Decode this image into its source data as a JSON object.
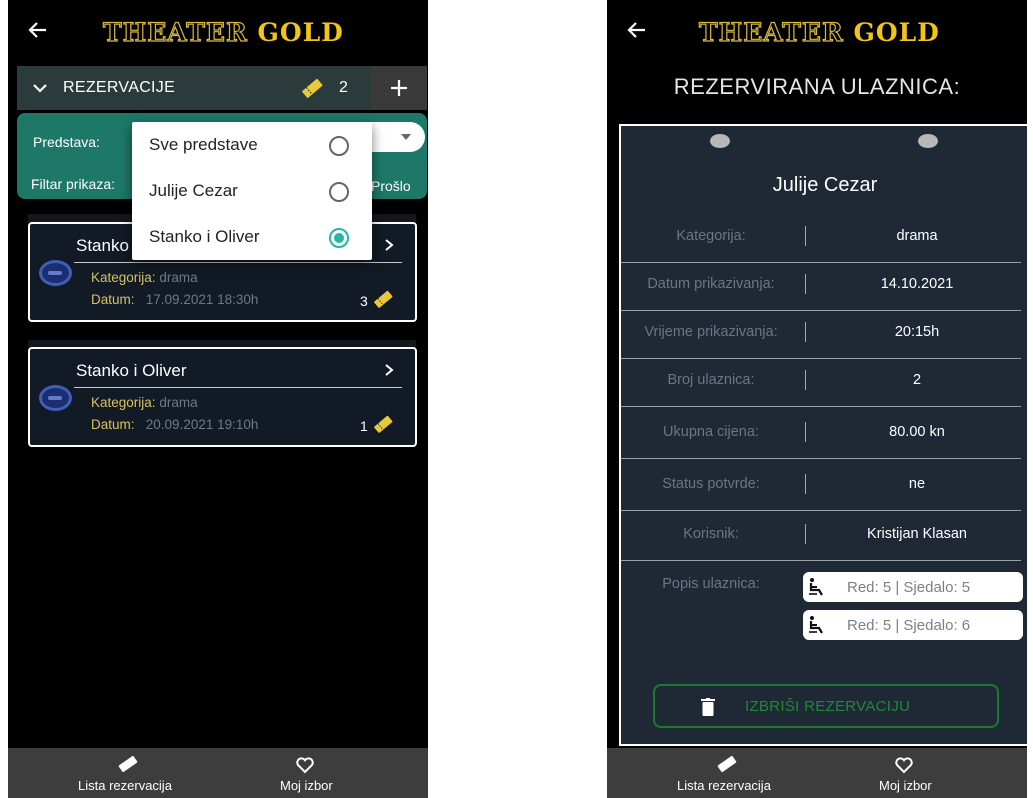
{
  "brand": {
    "word1": "THEATER",
    "word2": "GOLD"
  },
  "left_screen": {
    "section": {
      "title": "REZERVACIJE",
      "count": "2",
      "add_label": "+"
    },
    "filter": {
      "predstava_label": "Predstava:",
      "filtar_label": "Filtar prikaza:",
      "right_option": "Prošlo"
    },
    "dropdown": {
      "options": [
        {
          "label": "Sve predstave",
          "selected": false
        },
        {
          "label": "Julije Cezar",
          "selected": false
        },
        {
          "label": "Stanko i Oliver",
          "selected": true
        }
      ]
    },
    "cards": [
      {
        "title": "Stanko i Oliver",
        "kategorija_label": "Kategorija:",
        "kategorija": "drama",
        "datum_label": "Datum:",
        "datum": "17.09.2021 18:30h",
        "tickets": "3"
      },
      {
        "title": "Stanko i Oliver",
        "kategorija_label": "Kategorija:",
        "kategorija": "drama",
        "datum_label": "Datum:",
        "datum": "20.09.2021 19:10h",
        "tickets": "1"
      }
    ]
  },
  "right_screen": {
    "heading": "REZERVIRANA ULAZNICA:",
    "show_title": "Julije Cezar",
    "rows": [
      {
        "label": "Kategorija:",
        "value": "drama"
      },
      {
        "label": "Datum prikazivanja:",
        "value": "14.10.2021"
      },
      {
        "label": "Vrijeme prikazivanja:",
        "value": "20:15h"
      },
      {
        "label": "Broj ulaznica:",
        "value": "2"
      },
      {
        "label": "Ukupna cijena:",
        "value": "80.00  kn"
      },
      {
        "label": "Status potvrde:",
        "value": "ne"
      },
      {
        "label": "Korisnik:",
        "value": "Kristijan Klasan"
      }
    ],
    "seats_label": "Popis ulaznica:",
    "seats": [
      "Red: 5 | Sjedalo: 5",
      "Red: 5 | Sjedalo: 6"
    ],
    "delete_label": "IZBRIŠI REZERVACIJU"
  },
  "bottom_nav": {
    "item1": "Lista rezervacija",
    "item2": "Moj izbor"
  },
  "colors": {
    "accent_teal": "#1d7868",
    "gold": "#f2c515",
    "radio_on": "#21b8a4",
    "delete_green": "#1e8a33"
  },
  "icons": [
    "back-arrow-icon",
    "chevron-down-icon",
    "ticket-icon",
    "plus-icon",
    "chevron-right-icon",
    "theater-logo-icon",
    "seat-icon",
    "trash-icon",
    "heart-icon"
  ]
}
